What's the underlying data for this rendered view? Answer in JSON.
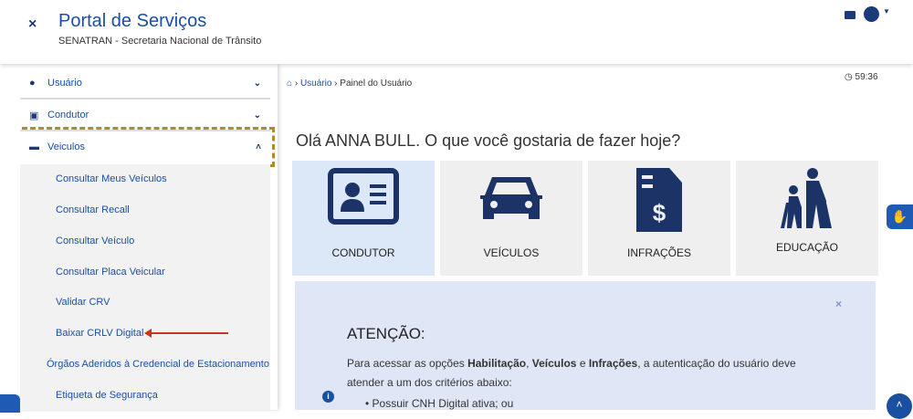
{
  "header": {
    "close": "×",
    "title": "Portal de Serviços",
    "subtitle": "SENATRAN - Secretaria Nacional de Trânsito"
  },
  "sidebar": {
    "items": [
      {
        "label": "Usuário"
      },
      {
        "label": "Condutor"
      },
      {
        "label": "Veiculos"
      }
    ],
    "subitems": [
      "Consultar Meus Veículos",
      "Consultar Recall",
      "Consultar Veículo",
      "Consultar Placa Veicular",
      "Validar CRV",
      "Baixar CRLV Digital",
      "Órgãos Aderidos à Credencial de Estacionamento",
      "Etiqueta de Segurança"
    ]
  },
  "breadcrumb": {
    "link": "Usuário",
    "current": "Painel do Usuário"
  },
  "timer": "59:36",
  "greeting": "Olá ANNA BULL. O que você gostaria de fazer hoje?",
  "cards": [
    "CONDUTOR",
    "VEÍCULOS",
    "INFRAÇÕES",
    "EDUCAÇÃO"
  ],
  "alert": {
    "title": "ATENÇÃO:",
    "text_1": "Para acessar as opções ",
    "b1": "Habilitação",
    "t2": ", ",
    "b2": "Veículos",
    "t3": " e ",
    "b3": "Infrações",
    "t4": ", a autenticação do usuário deve atender a um dos critérios abaixo:",
    "bullet": "• Possuir CNH Digital ativa; ou",
    "close": "×"
  }
}
